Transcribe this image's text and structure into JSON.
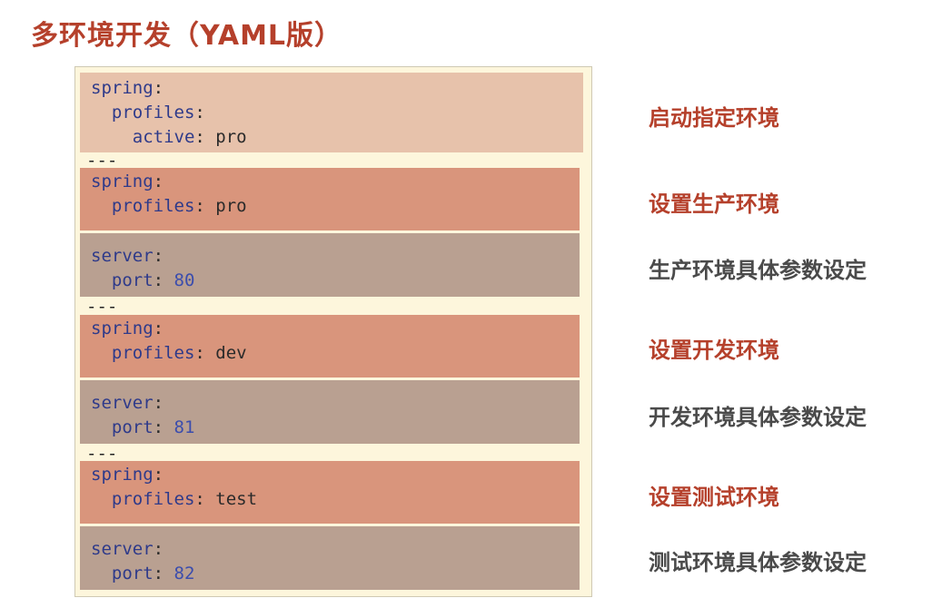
{
  "title": "多环境开发（YAML版）",
  "code": {
    "separator": "---",
    "block_activate": {
      "line1_key": "spring",
      "line2_key": "profiles",
      "line3_key": "active",
      "line3_value": "pro"
    },
    "doc_pro": {
      "profile_key1": "spring",
      "profile_key2": "profiles",
      "profile_value": "pro",
      "server_key1": "server",
      "server_key2": "port",
      "server_value": "80"
    },
    "doc_dev": {
      "profile_key1": "spring",
      "profile_key2": "profiles",
      "profile_value": "dev",
      "server_key1": "server",
      "server_key2": "port",
      "server_value": "81"
    },
    "doc_test": {
      "profile_key1": "spring",
      "profile_key2": "profiles",
      "profile_value": "test",
      "server_key1": "server",
      "server_key2": "port",
      "server_value": "82"
    }
  },
  "labels": {
    "activate": "启动指定环境",
    "set_pro": "设置生产环境",
    "pro_params": "生产环境具体参数设定",
    "set_dev": "设置开发环境",
    "dev_params": "开发环境具体参数设定",
    "set_test": "设置测试环境",
    "test_params": "测试环境具体参数设定"
  },
  "colors": {
    "accent": "#b5402b",
    "panel_bg": "#fdf6dc",
    "activate_block": "#e7c2ab",
    "profile_block": "#d9957c",
    "server_block": "#b9a091",
    "key_color": "#2e3a8a",
    "number_color": "#3b4dad"
  }
}
